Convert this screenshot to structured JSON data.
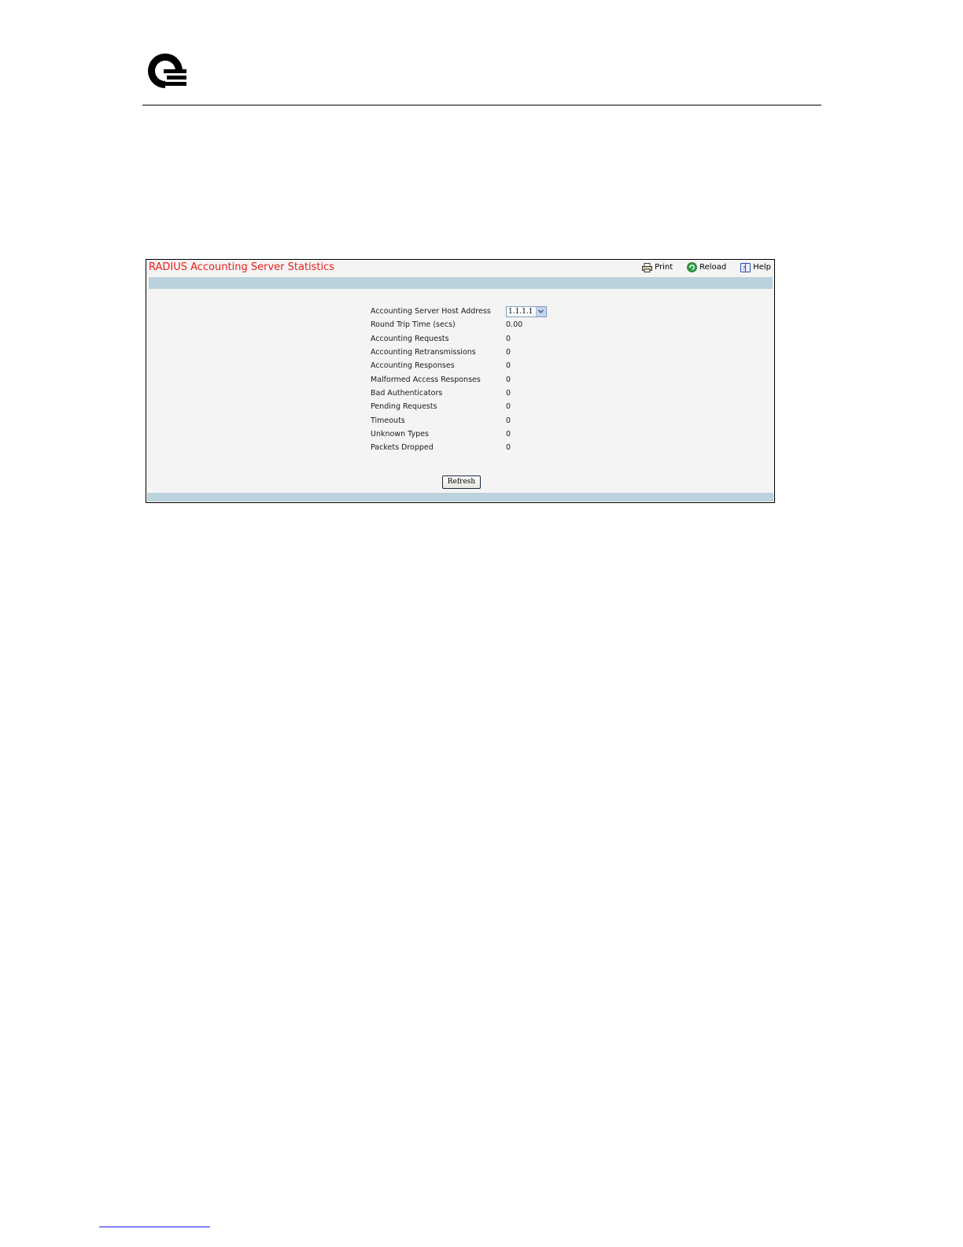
{
  "panel": {
    "title": "RADIUS Accounting Server Statistics",
    "toolbar": {
      "print_label": "Print",
      "reload_label": "Reload",
      "help_label": "Help"
    },
    "host_address": {
      "label": "Accounting Server Host Address",
      "selected": "1.1.1.1"
    },
    "stats": [
      {
        "label": "Round Trip Time (secs)",
        "value": "0.00"
      },
      {
        "label": "Accounting Requests",
        "value": "0"
      },
      {
        "label": "Accounting Retransmissions",
        "value": "0"
      },
      {
        "label": "Accounting Responses",
        "value": "0"
      },
      {
        "label": "Malformed Access Responses",
        "value": "0"
      },
      {
        "label": "Bad Authenticators",
        "value": "0"
      },
      {
        "label": "Pending Requests",
        "value": "0"
      },
      {
        "label": "Timeouts",
        "value": "0"
      },
      {
        "label": "Unknown Types",
        "value": "0"
      },
      {
        "label": "Packets Dropped",
        "value": "0"
      }
    ],
    "refresh_label": "Refresh"
  },
  "colors": {
    "title": "#e8211c",
    "bar": "#bcd2dc",
    "panel_bg": "#f4f4f4"
  },
  "icons": {
    "logo": "q-logo",
    "print": "printer-icon",
    "reload": "reload-icon",
    "help": "help-book-icon",
    "dropdown": "chevron-down-icon"
  }
}
